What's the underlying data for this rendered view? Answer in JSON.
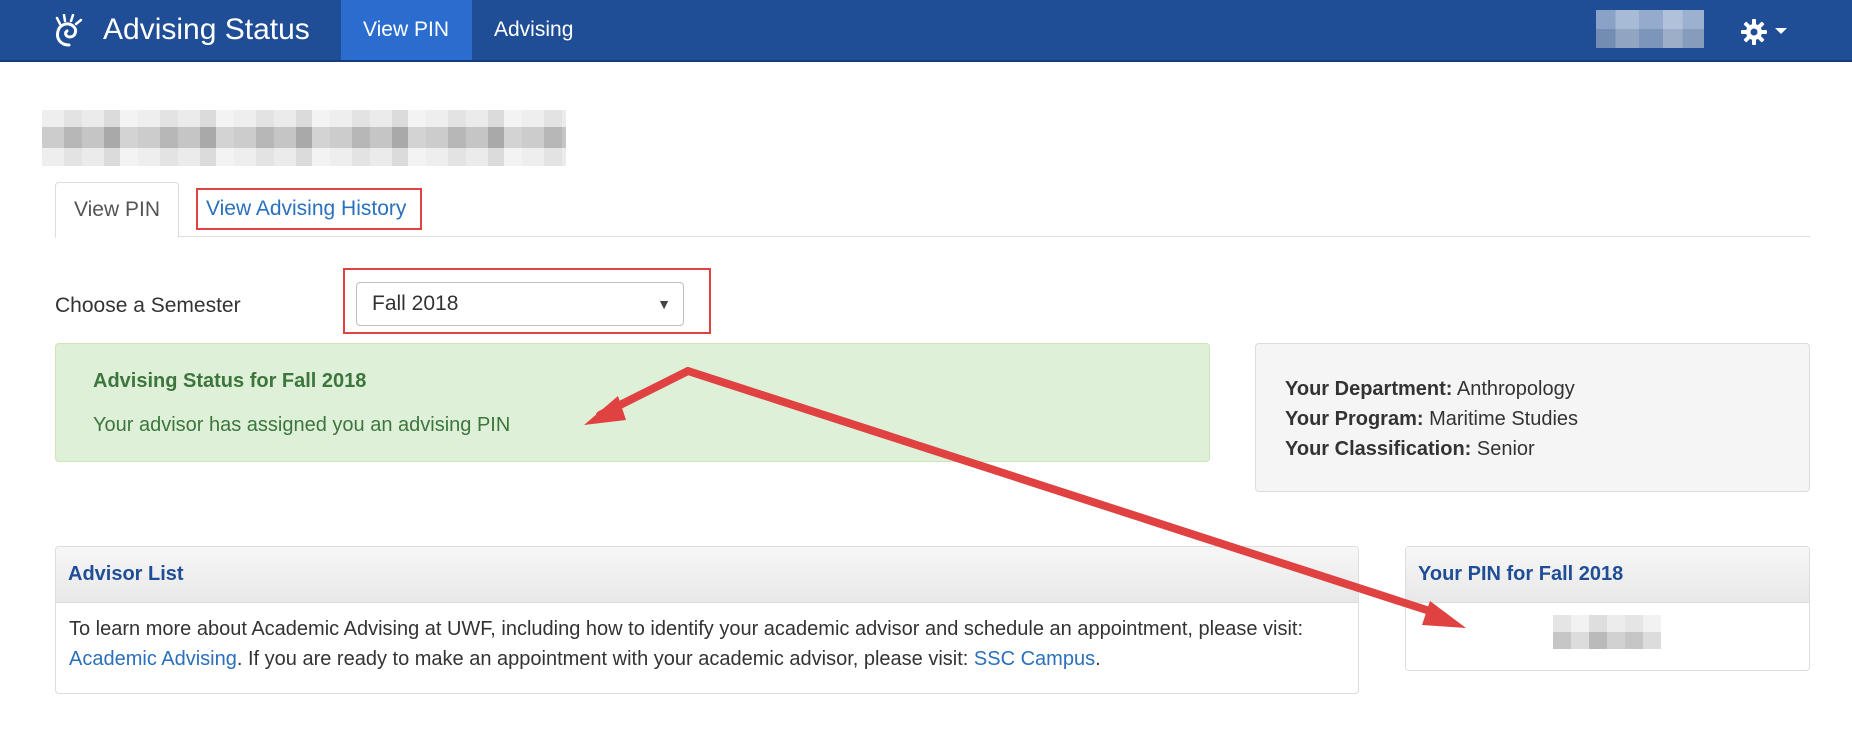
{
  "navbar": {
    "title": "Advising Status",
    "items": [
      {
        "label": "View PIN",
        "active": true
      },
      {
        "label": "Advising",
        "active": false
      }
    ],
    "settings_icon": "gear-icon",
    "brand_icon": "shell-logo-icon",
    "color": "#1f4e96",
    "active_color": "#2b6ccf"
  },
  "tabs": [
    {
      "label": "View PIN",
      "active": true
    },
    {
      "label": "View Advising History",
      "active": false
    }
  ],
  "semester": {
    "label": "Choose a Semester",
    "selected": "Fall 2018"
  },
  "status": {
    "title": "Advising Status for Fall 2018",
    "message": "Your advisor has assigned you an advising PIN"
  },
  "info": {
    "department_label": "Your Department:",
    "department_value": "Anthropology",
    "program_label": "Your Program:",
    "program_value": "Maritime Studies",
    "classification_label": "Your Classification:",
    "classification_value": "Senior"
  },
  "advisor": {
    "title": "Advisor List",
    "text_1": "To learn more about Academic Advising at UWF, including how to identify your academic advisor and schedule an appointment, please visit: ",
    "link_1": "Academic Advising",
    "text_2": ". If you are ready to make an appointment with your academic advisor, please visit: ",
    "link_2": "SSC Campus",
    "text_3": "."
  },
  "pin": {
    "title": "Your PIN for Fall 2018"
  },
  "annotation_color": "#e04141"
}
